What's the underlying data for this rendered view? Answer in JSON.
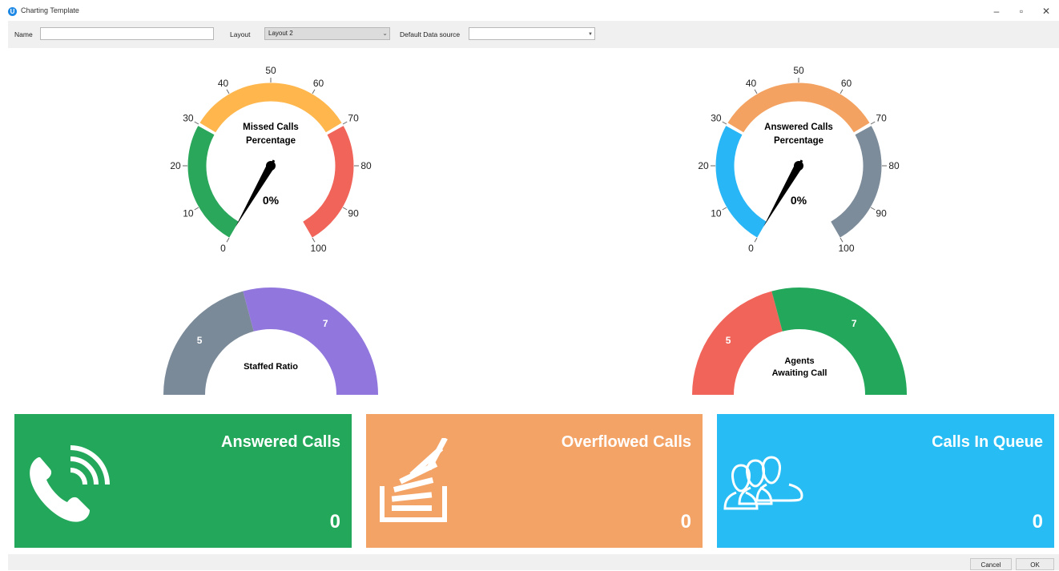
{
  "window": {
    "title": "Charting Template",
    "minimize": "–",
    "restore": "▫",
    "close": "✕"
  },
  "toolbar": {
    "name_label": "Name",
    "name_value": "",
    "layout_label": "Layout",
    "layout_value": "Layout 2",
    "data_source_label": "Default Data source",
    "data_source_value": ""
  },
  "gauges": {
    "missed": {
      "title_line1": "Missed Calls",
      "title_line2": "Percentage",
      "value_text": "0%",
      "value": 0,
      "ticks": [
        "0",
        "10",
        "20",
        "30",
        "40",
        "50",
        "60",
        "70",
        "80",
        "90",
        "100"
      ],
      "colors": [
        "#2aa75b",
        "#ffb74d",
        "#f0645a"
      ]
    },
    "answered": {
      "title_line1": "Answered Calls",
      "title_line2": "Percentage",
      "value_text": "0%",
      "value": 0,
      "ticks": [
        "0",
        "10",
        "20",
        "30",
        "40",
        "50",
        "60",
        "70",
        "80",
        "90",
        "100"
      ],
      "colors": [
        "#29b6f6",
        "#f4a261",
        "#7d8c9a"
      ]
    }
  },
  "half_donuts": {
    "staffed": {
      "title": "Staffed Ratio",
      "values": [
        5,
        7
      ],
      "labels": [
        "5",
        "7"
      ],
      "colors": [
        "#7a8a99",
        "#9176dd"
      ]
    },
    "agents": {
      "title_line1": "Agents",
      "title_line2": "Awaiting Call",
      "values": [
        5,
        7
      ],
      "labels": [
        "5",
        "7"
      ],
      "colors": [
        "#f0645a",
        "#23a85b"
      ]
    }
  },
  "tiles": [
    {
      "title": "Answered Calls",
      "value": "0",
      "color": "#23a85b",
      "icon": "phone-icon"
    },
    {
      "title": "Overflowed Calls",
      "value": "0",
      "color": "#f4a367",
      "icon": "stack-icon"
    },
    {
      "title": "Calls In Queue",
      "value": "0",
      "color": "#27bdf4",
      "icon": "users-icon"
    }
  ],
  "footer": {
    "cancel_label": "Cancel",
    "ok_label": "OK"
  }
}
